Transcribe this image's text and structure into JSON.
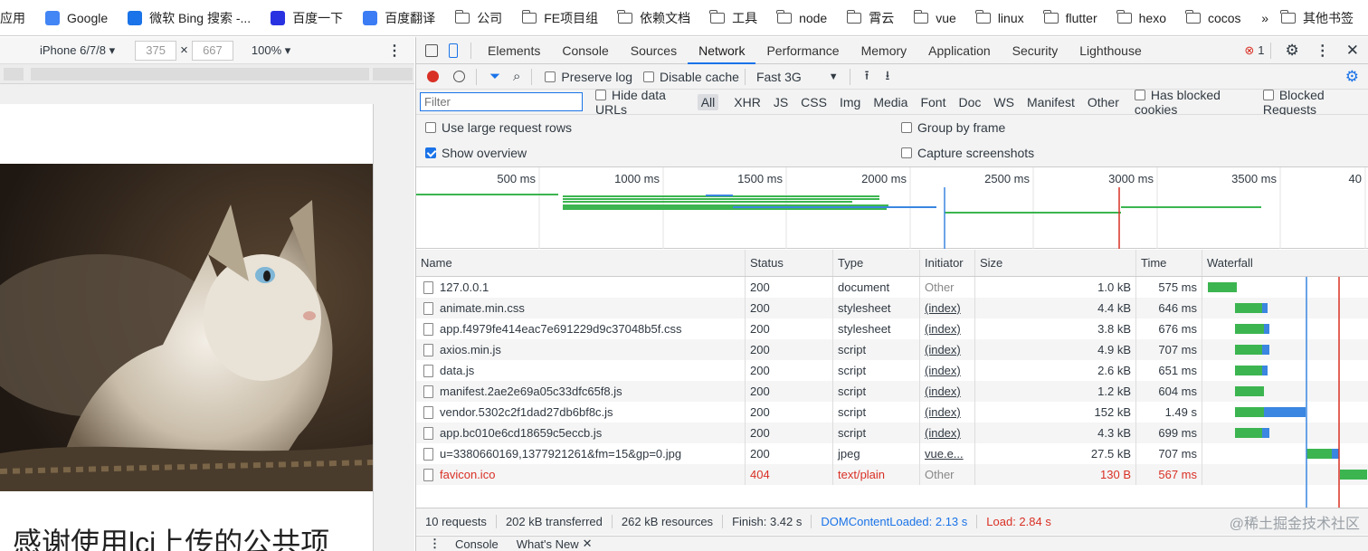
{
  "bookmarks": {
    "items": [
      {
        "label": "应用",
        "icon": "apps-icon"
      },
      {
        "label": "Google",
        "icon": "google-icon"
      },
      {
        "label": "微软 Bing 搜索 -...",
        "icon": "bing-icon"
      },
      {
        "label": "百度一下",
        "icon": "baidu-icon"
      },
      {
        "label": "百度翻译",
        "icon": "translate-icon"
      },
      {
        "label": "公司",
        "icon": "folder-icon"
      },
      {
        "label": "FE项目组",
        "icon": "folder-icon"
      },
      {
        "label": "依赖文档",
        "icon": "folder-icon"
      },
      {
        "label": "工具",
        "icon": "folder-icon"
      },
      {
        "label": "node",
        "icon": "folder-icon"
      },
      {
        "label": "霄云",
        "icon": "folder-icon"
      },
      {
        "label": "vue",
        "icon": "folder-icon"
      },
      {
        "label": "linux",
        "icon": "folder-icon"
      },
      {
        "label": "flutter",
        "icon": "folder-icon"
      },
      {
        "label": "hexo",
        "icon": "folder-icon"
      },
      {
        "label": "cocos",
        "icon": "folder-icon"
      }
    ],
    "more": "»",
    "other": "其他书签"
  },
  "device": {
    "name": "iPhone 6/7/8 ▾",
    "width": "375",
    "height": "667",
    "times": "×",
    "zoom": "100% ▾"
  },
  "page": {
    "heading": "感谢使用lci上传的公共项"
  },
  "tabs": [
    "Elements",
    "Console",
    "Sources",
    "Network",
    "Performance",
    "Memory",
    "Application",
    "Security",
    "Lighthouse"
  ],
  "active_tab": "Network",
  "error_count": "1",
  "toolbar": {
    "preserve_log": "Preserve log",
    "disable_cache": "Disable cache",
    "throttle": "Fast 3G"
  },
  "filter": {
    "placeholder": "Filter",
    "hide_data_urls": "Hide data URLs",
    "types": [
      "All",
      "XHR",
      "JS",
      "CSS",
      "Img",
      "Media",
      "Font",
      "Doc",
      "WS",
      "Manifest",
      "Other"
    ],
    "blocked_cookies": "Has blocked cookies",
    "blocked_requests": "Blocked Requests"
  },
  "options": {
    "large_rows": "Use large request rows",
    "group_by_frame": "Group by frame",
    "show_overview": "Show overview",
    "capture_screenshots": "Capture screenshots"
  },
  "overview_ticks": [
    "500 ms",
    "1000 ms",
    "1500 ms",
    "2000 ms",
    "2500 ms",
    "3000 ms",
    "3500 ms",
    "40"
  ],
  "columns": [
    "Name",
    "Status",
    "Type",
    "Initiator",
    "Size",
    "Time",
    "Waterfall"
  ],
  "requests": [
    {
      "name": "127.0.0.1",
      "status": "200",
      "type": "document",
      "initiator": "Other",
      "size": "1.0 kB",
      "time": "575 ms"
    },
    {
      "name": "animate.min.css",
      "status": "200",
      "type": "stylesheet",
      "initiator": "(index)",
      "size": "4.4 kB",
      "time": "646 ms"
    },
    {
      "name": "app.f4979fe414eac7e691229d9c37048b5f.css",
      "status": "200",
      "type": "stylesheet",
      "initiator": "(index)",
      "size": "3.8 kB",
      "time": "676 ms"
    },
    {
      "name": "axios.min.js",
      "status": "200",
      "type": "script",
      "initiator": "(index)",
      "size": "4.9 kB",
      "time": "707 ms"
    },
    {
      "name": "data.js",
      "status": "200",
      "type": "script",
      "initiator": "(index)",
      "size": "2.6 kB",
      "time": "651 ms"
    },
    {
      "name": "manifest.2ae2e69a05c33dfc65f8.js",
      "status": "200",
      "type": "script",
      "initiator": "(index)",
      "size": "1.2 kB",
      "time": "604 ms"
    },
    {
      "name": "vendor.5302c2f1dad27db6bf8c.js",
      "status": "200",
      "type": "script",
      "initiator": "(index)",
      "size": "152 kB",
      "time": "1.49 s"
    },
    {
      "name": "app.bc010e6cd18659c5eccb.js",
      "status": "200",
      "type": "script",
      "initiator": "(index)",
      "size": "4.3 kB",
      "time": "699 ms"
    },
    {
      "name": "u=3380660169,1377921261&fm=15&gp=0.jpg",
      "status": "200",
      "type": "jpeg",
      "initiator": "vue.e...",
      "size": "27.5 kB",
      "time": "707 ms"
    },
    {
      "name": "favicon.ico",
      "status": "404",
      "type": "text/plain",
      "initiator": "Other",
      "size": "130 B",
      "time": "567 ms"
    }
  ],
  "summary": {
    "requests": "10 requests",
    "transferred": "202 kB transferred",
    "resources": "262 kB resources",
    "finish": "Finish: 3.42 s",
    "dcl": "DOMContentLoaded: 2.13 s",
    "load": "Load: 2.84 s"
  },
  "watermark": "@稀土掘金技术社区",
  "drawer": {
    "console": "Console",
    "whatsnew": "What's New"
  },
  "colors": {
    "accent": "#1a73e8",
    "error": "#d93025",
    "green": "#3cb550",
    "blue": "#3a86e0"
  }
}
